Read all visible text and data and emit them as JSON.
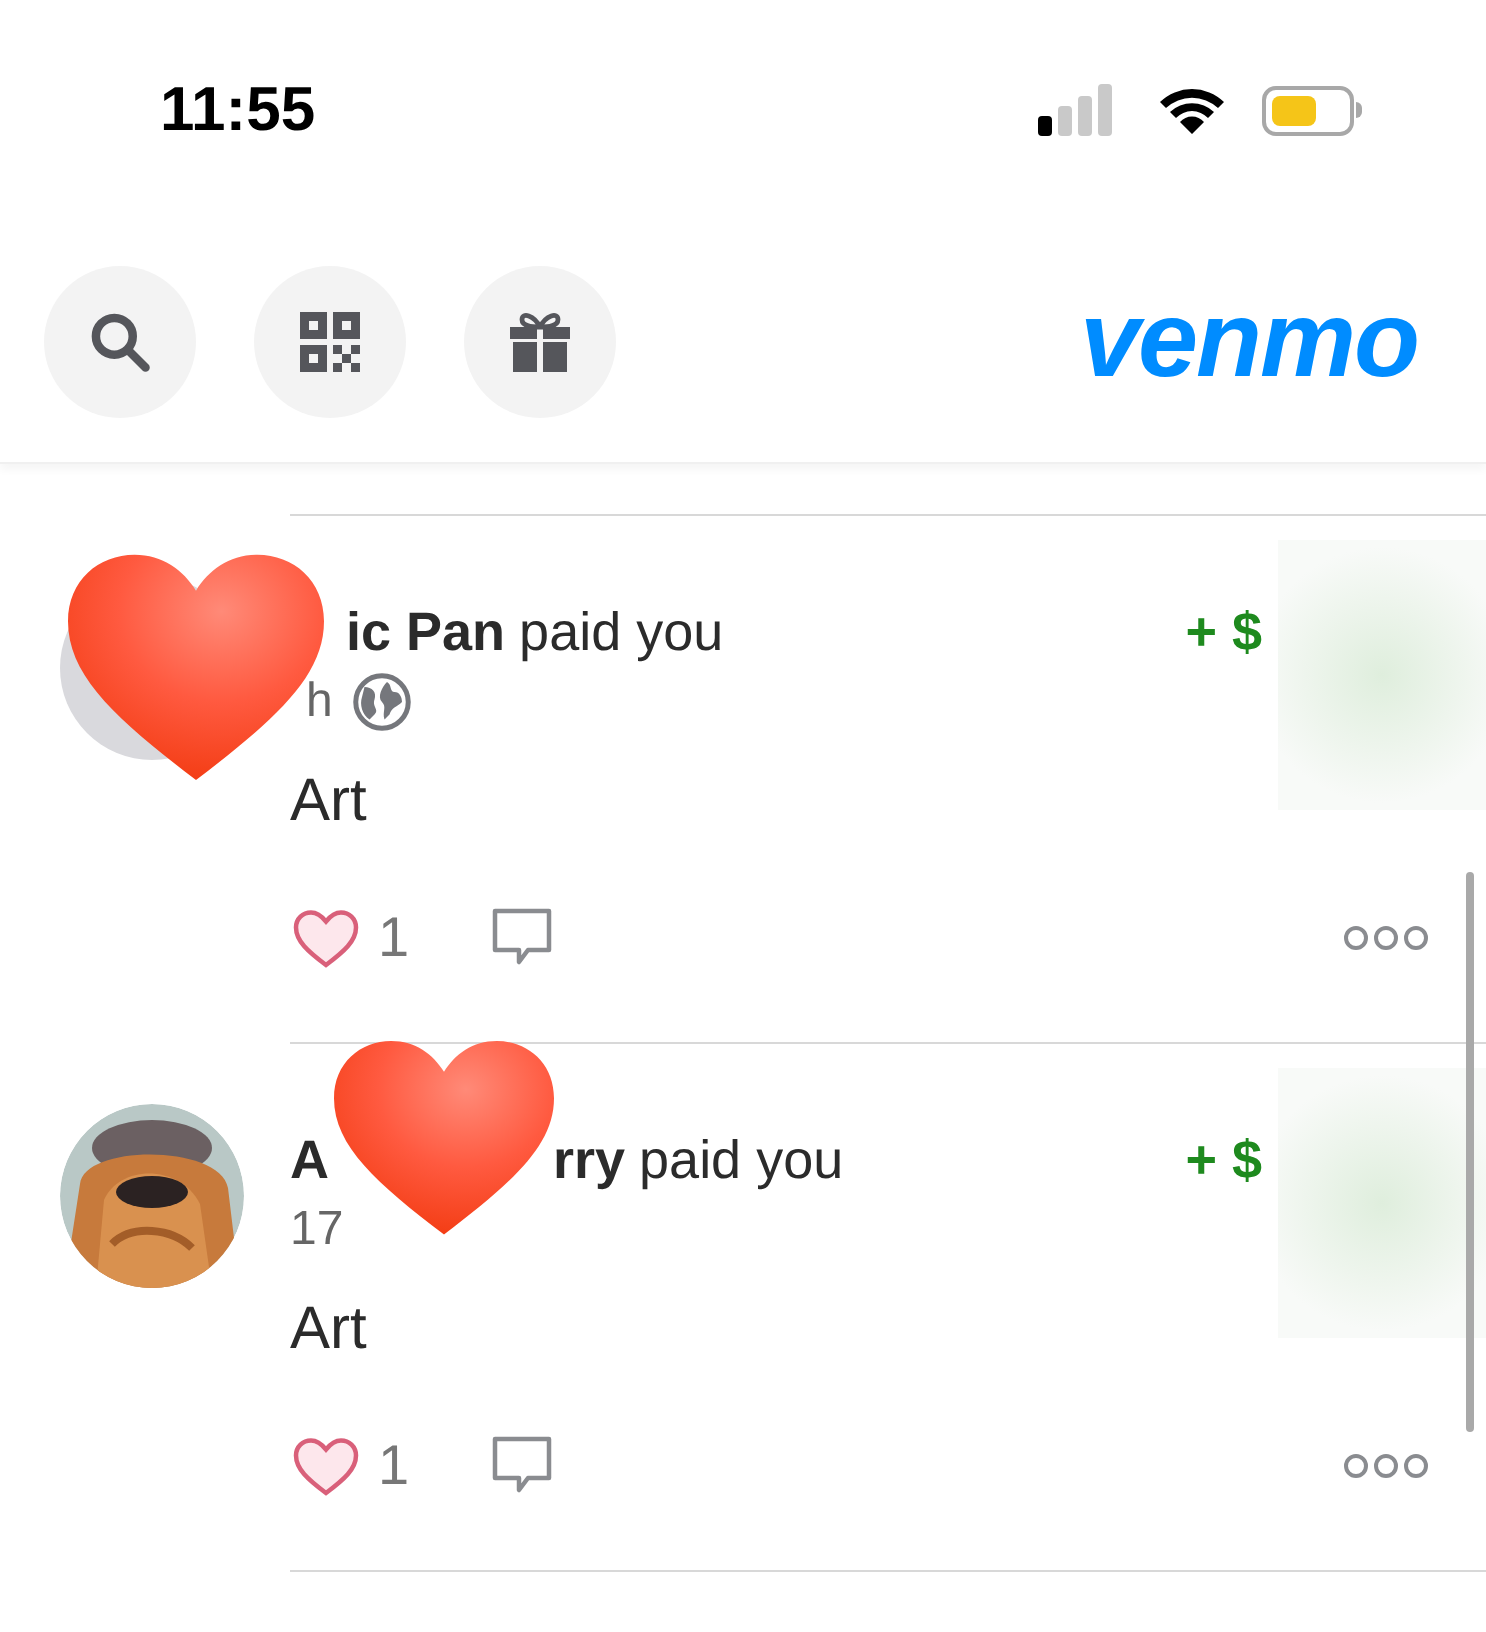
{
  "status_bar": {
    "time": "11:55",
    "low_power": true
  },
  "header": {
    "buttons": [
      {
        "kind": "search"
      },
      {
        "kind": "qr"
      },
      {
        "kind": "gift"
      }
    ],
    "logo": "venmo"
  },
  "feed": [
    {
      "avatar": {
        "kind": "covered"
      },
      "actor": [
        "ic Pan"
      ],
      "verb": "paid you",
      "time": "h",
      "public": true,
      "amount": "+ $",
      "note": "Art",
      "likes": "1",
      "liked": false
    },
    {
      "avatar": {
        "kind": "picture"
      },
      "actor": [
        "A",
        "rry"
      ],
      "verb": "paid you",
      "time": "17",
      "public": false,
      "amount": "+ $",
      "note": "Art",
      "likes": "1",
      "liked": false
    }
  ]
}
